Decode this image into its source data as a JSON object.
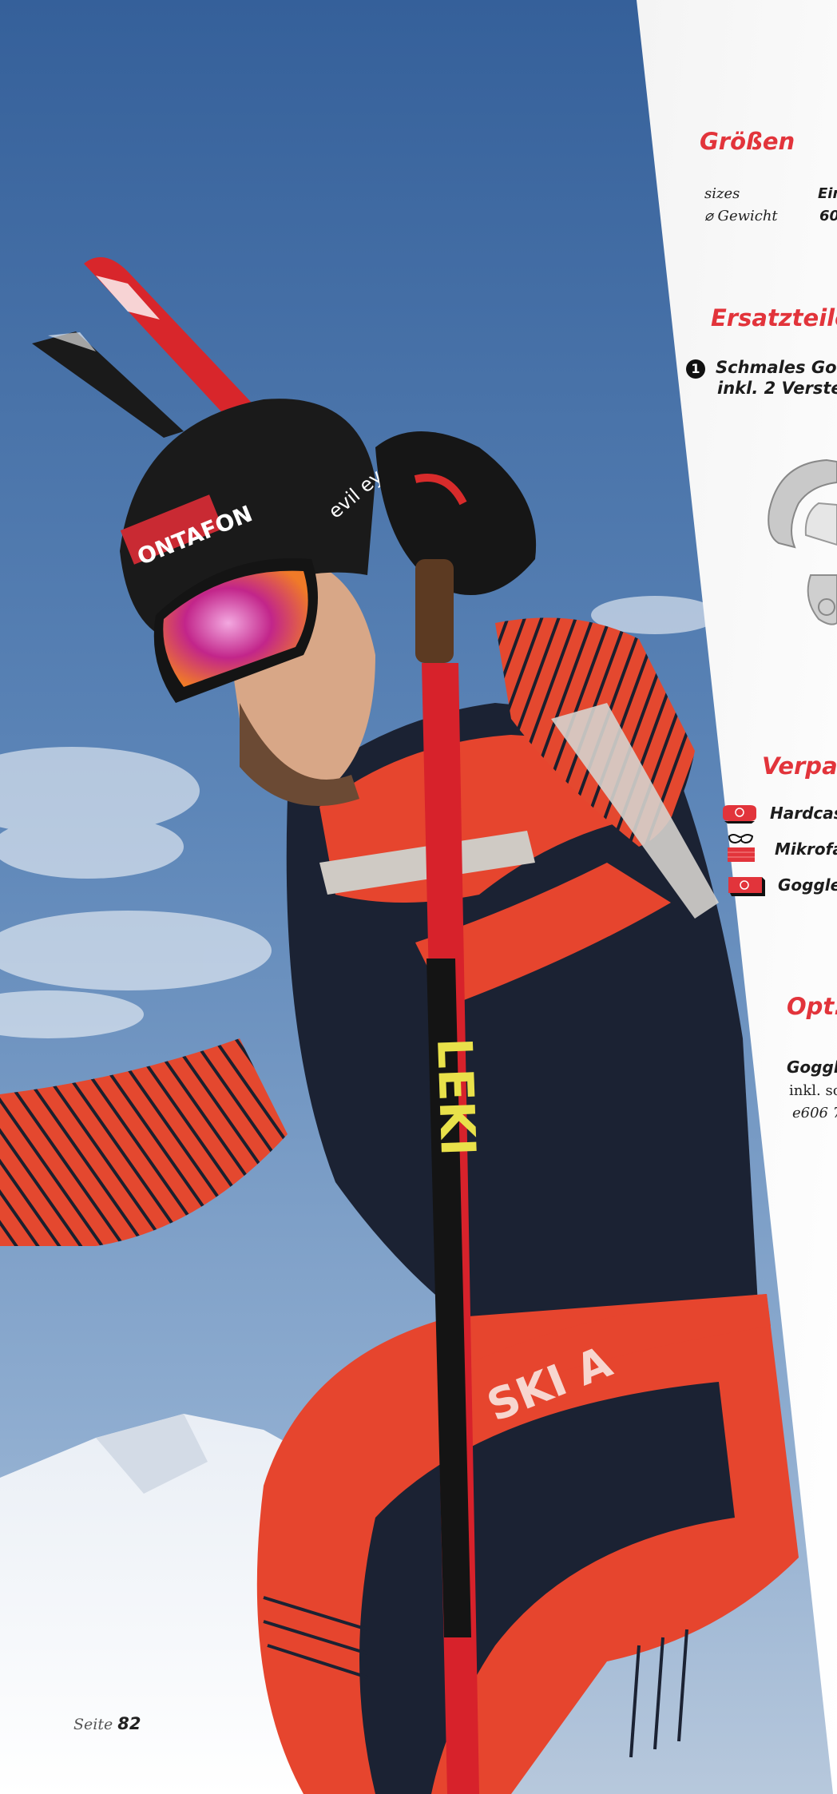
{
  "page": {
    "label": "Seite",
    "number": "82"
  },
  "sections": {
    "sizes": {
      "heading": "Größen",
      "rows": [
        {
          "label": "sizes",
          "value": "Ein"
        },
        {
          "label": "⌀ Gewicht",
          "value": "60"
        }
      ]
    },
    "spare_parts": {
      "heading": "Ersatzteile",
      "item_number": "1",
      "item_line1": "Schmales Gogg",
      "item_line2": "inkl. 2 Verstells"
    },
    "packaging": {
      "heading": "Verpac",
      "items": [
        {
          "icon": "hardcase-icon",
          "label": "Hardcas"
        },
        {
          "icon": "microfiber-bag-icon",
          "label": "Mikrofa"
        },
        {
          "icon": "goggle-case-icon",
          "label": "Goggle"
        }
      ]
    },
    "optional": {
      "heading": "Opt.",
      "line1": "Goggl",
      "line2": "inkl. sch",
      "line3": "e606 7"
    }
  },
  "photo": {
    "helmet_text": "ONTAFON",
    "helmet_brand": "evil ey",
    "pole_text": "LEKI",
    "suit_text": "SKI A"
  },
  "colors": {
    "accent_red": "#e2343b",
    "sky": "#5b84b7",
    "suit_red": "#e6452e",
    "suit_navy": "#1b2233"
  }
}
